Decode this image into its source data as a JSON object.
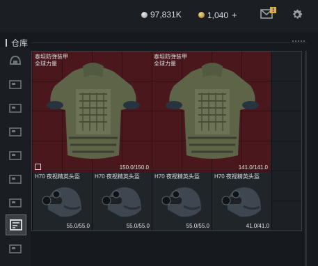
{
  "topbar": {
    "silver_amount": "97,831K",
    "gold_amount": "1,040",
    "gold_plus": "+",
    "mail_badge": "!"
  },
  "section": {
    "title": "仓库"
  },
  "sidebar": {
    "items": [
      {
        "icon": "helmet-slot-icon"
      },
      {
        "icon": "box-category-icon"
      },
      {
        "icon": "box-category-icon"
      },
      {
        "icon": "box-category-icon"
      },
      {
        "icon": "box-category-icon"
      },
      {
        "icon": "box-category-icon"
      },
      {
        "icon": "box-category-icon"
      },
      {
        "icon": "box-category-icon"
      },
      {
        "icon": "gear-crate-icon",
        "active": true
      },
      {
        "icon": "box-category-icon"
      }
    ]
  },
  "inventory": {
    "armors": [
      {
        "name_line1": "泰坦防弹装甲",
        "name_line2": "全球力量",
        "durability": "150.0/150.0"
      },
      {
        "name_line1": "泰坦防弹装甲",
        "name_line2": "全球力量",
        "durability": "141.0/141.0"
      }
    ],
    "helmets": [
      {
        "name": "H70 夜视精英头盔",
        "durability": "55.0/55.0"
      },
      {
        "name": "H70 夜视精英头盔",
        "durability": "55.0/55.0"
      },
      {
        "name": "H70 夜视精英头盔",
        "durability": "55.0/55.0"
      },
      {
        "name": "H70 夜视精英头盔",
        "durability": "41.0/41.0"
      }
    ]
  },
  "colors": {
    "armor_bg": "#4a181c",
    "coin_gold": "#c9a24a",
    "badge": "#e2b236"
  }
}
